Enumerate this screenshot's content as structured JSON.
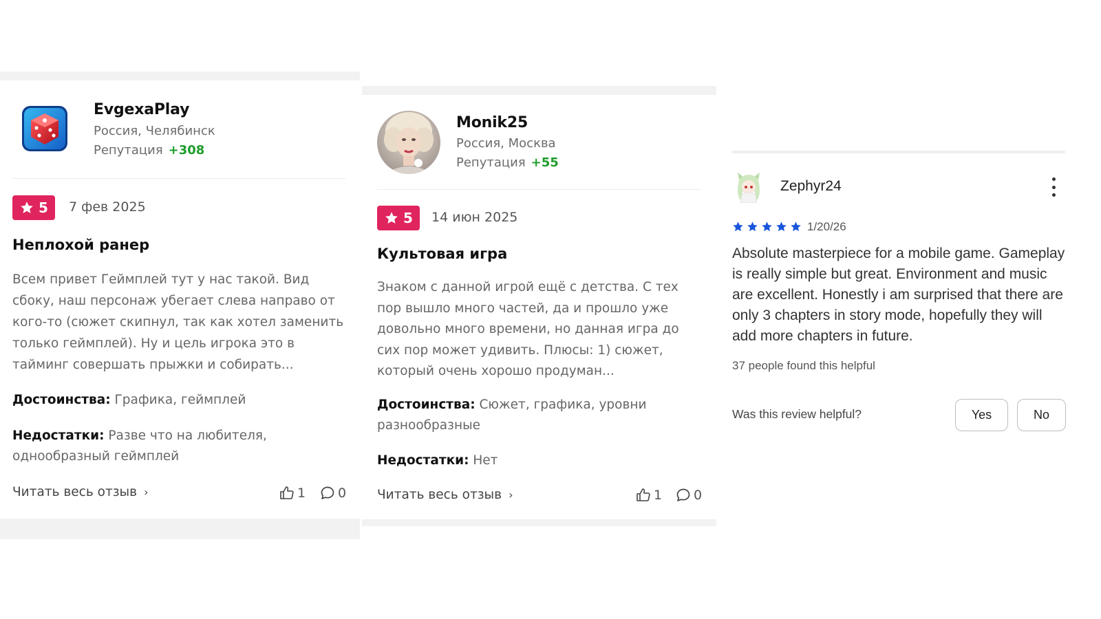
{
  "reviews_ru": [
    {
      "username": "EvgexaPlay",
      "location": "Россия, Челябинск",
      "reputation_label": "Репутация",
      "reputation_value": "+308",
      "rating": "5",
      "date": "7 фев 2025",
      "title": "Неплохой ранер",
      "body": "Всем привет Геймплей тут у нас такой. Вид сбоку, наш персонаж убегает слева направо от кого-то (сюжет скипнул, так как хотел заменить только геймплей). Ну и цель игрока это в тайминг совершать прыжки и собирать...",
      "pros_label": "Достоинства:",
      "pros": "Графика, геймплей",
      "cons_label": "Недостатки:",
      "cons": "Разве что на любителя, однообразный геймплей",
      "read_more": "Читать весь отзыв",
      "likes": "1",
      "comments": "0",
      "avatar_icon": "red-dice-icon"
    },
    {
      "username": "Monik25",
      "location": "Россия, Москва",
      "reputation_label": "Репутация",
      "reputation_value": "+55",
      "rating": "5",
      "date": "14 июн 2025",
      "title": "Культовая игра",
      "body": "Знаком с данной игрой ещё с детства. С тех пор вышло много частей, да и прошло уже довольно много времени, но данная игра до сих пор может удивить. Плюсы: 1) сюжет, который очень хорошо продуман...",
      "pros_label": "Достоинства:",
      "pros": "Сюжет, графика, уровни разнообразные",
      "cons_label": "Недостатки:",
      "cons": "Нет",
      "read_more": "Читать весь отзыв",
      "likes": "1",
      "comments": "0",
      "avatar_icon": "portrait-photo"
    }
  ],
  "review_gp": {
    "username": "Zephyr24",
    "stars": 5,
    "date": "1/20/26",
    "text": "Absolute masterpiece for a mobile game. Gameplay is really simple but great. Environment and music are excellent. Honestly i am surprised that there are only 3 chapters in story mode, hopefully they will add more chapters in future.",
    "helpful_count_text": "37 people found this helpful",
    "question": "Was this review helpful?",
    "yes_label": "Yes",
    "no_label": "No",
    "avatar_icon": "anime-girl-avatar"
  },
  "colors": {
    "rating_badge": "#e0245e",
    "reputation_green": "#1f9d2c",
    "gp_star_blue": "#1a56db"
  }
}
